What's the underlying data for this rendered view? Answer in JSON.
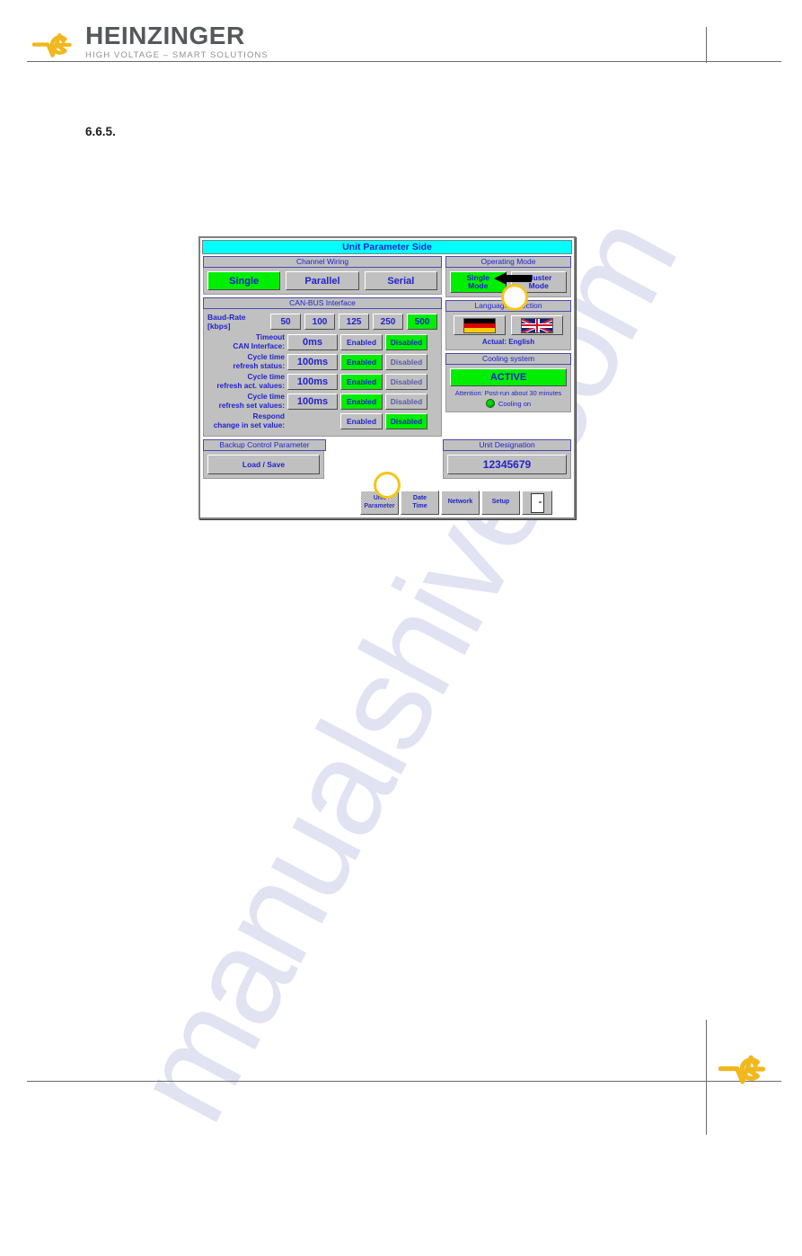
{
  "document": {
    "brand_name": "HEINZINGER",
    "brand_tagline": "HIGH VOLTAGE – SMART SOLUTIONS",
    "section_number": "6.6.5.",
    "watermark": "manualshive.com",
    "accent_yellow": "#f0b81e",
    "brand_gray": "#55595b"
  },
  "hmi": {
    "title": "Unit Parameter Side",
    "title_bg": "#00ffff",
    "text_blue": "#2222cc",
    "active_green": "#00ee00",
    "panel_gray": "#c0c0c0",
    "channel_wiring": {
      "header": "Channel Wiring",
      "options": [
        {
          "label": "Single",
          "selected": true
        },
        {
          "label": "Parallel",
          "selected": false
        },
        {
          "label": "Serial",
          "selected": false
        }
      ]
    },
    "can_bus": {
      "header": "CAN-BUS Interface",
      "baud_label": "Baud-Rate [kbps]",
      "baud_options": [
        {
          "label": "50",
          "selected": false
        },
        {
          "label": "100",
          "selected": false
        },
        {
          "label": "125",
          "selected": false
        },
        {
          "label": "250",
          "selected": false
        },
        {
          "label": "500",
          "selected": true
        }
      ],
      "rows": [
        {
          "label_line1": "Timeout",
          "label_line2": "CAN Interface:",
          "value": "0ms",
          "has_value": true,
          "enabled_label": "Enabled",
          "disabled_label": "Disabled",
          "state": "Disabled"
        },
        {
          "label_line1": "Cycle time",
          "label_line2": "refresh status:",
          "value": "100ms",
          "has_value": true,
          "enabled_label": "Enabled",
          "disabled_label": "Disabled",
          "state": "Enabled"
        },
        {
          "label_line1": "Cycle time",
          "label_line2": "refresh act. values:",
          "value": "100ms",
          "has_value": true,
          "enabled_label": "Enabled",
          "disabled_label": "Disabled",
          "state": "Enabled"
        },
        {
          "label_line1": "Cycle time",
          "label_line2": "refresh set values:",
          "value": "100ms",
          "has_value": true,
          "enabled_label": "Enabled",
          "disabled_label": "Disabled",
          "state": "Enabled"
        },
        {
          "label_line1": "Respond",
          "label_line2": "change in set value:",
          "value": "",
          "has_value": false,
          "enabled_label": "Enabled",
          "disabled_label": "Disabled",
          "state": "Disabled"
        }
      ]
    },
    "operating_mode": {
      "header": "Operating Mode",
      "options": [
        {
          "line1": "Single",
          "line2": "Mode",
          "selected": true
        },
        {
          "line1": "Cluster",
          "line2": "Mode",
          "selected": false
        }
      ]
    },
    "language": {
      "header": "Language Selection",
      "flags": [
        {
          "name": "german-flag",
          "selected": false
        },
        {
          "name": "english-flag",
          "selected": true
        }
      ],
      "actual": "Actual: English"
    },
    "cooling": {
      "header": "Cooling system",
      "status": "ACTIVE",
      "note": "Attention: Post-run about 30 minutes",
      "led_label": "Cooling on",
      "led_color": "#00dd00"
    },
    "backup": {
      "header": "Backup Control Parameter",
      "button": "Load / Save"
    },
    "unit_designation": {
      "header": "Unit Designation",
      "value": "12345679"
    },
    "tabs": [
      {
        "line1": "Unit",
        "line2": "Parameter",
        "active": true
      },
      {
        "line1": "Date",
        "line2": "Time",
        "active": false
      },
      {
        "line1": "Network",
        "line2": "",
        "active": false
      },
      {
        "line1": "Setup",
        "line2": "",
        "active": false
      }
    ],
    "exit_tab": {
      "icon": "door-exit-icon"
    }
  },
  "annotations": {
    "arrow_color": "#000000",
    "circle_color": "#f5c518"
  }
}
